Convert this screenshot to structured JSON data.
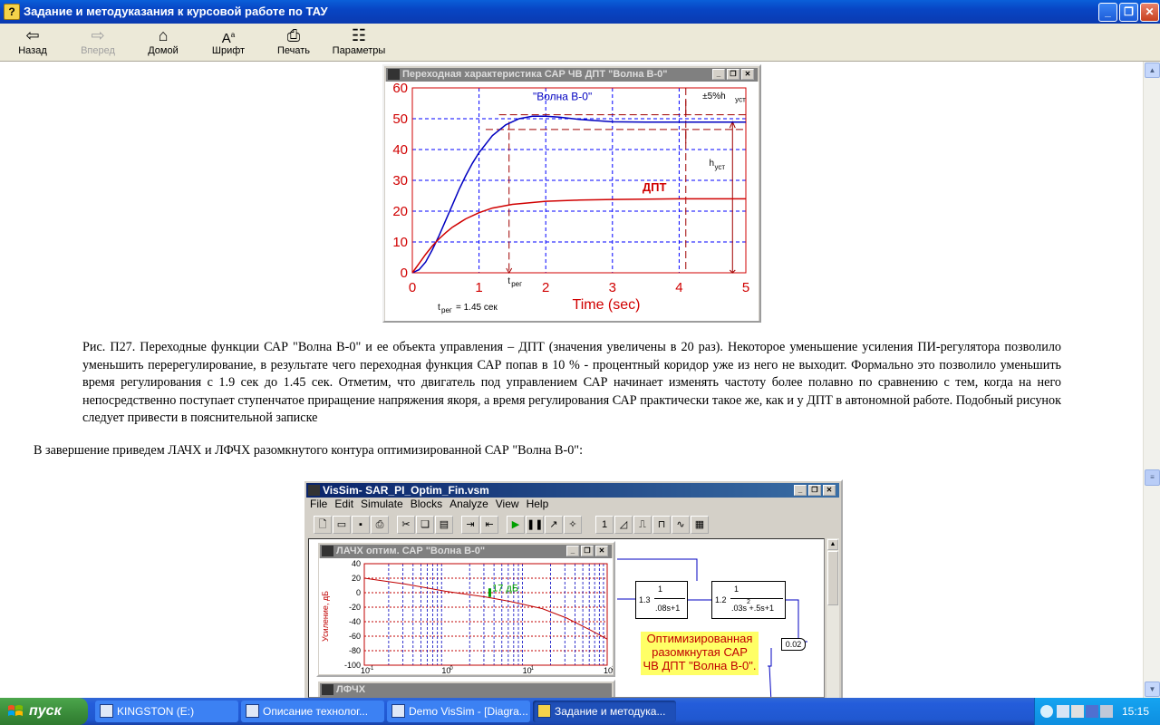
{
  "window": {
    "title": "Задание и методуказания к курсовой работе по ТАУ",
    "icon_letter": "?"
  },
  "toolbar": {
    "back": "Назад",
    "forward": "Вперед",
    "home": "Домой",
    "font": "Шрифт",
    "print": "Печать",
    "options": "Параметры"
  },
  "chart_window": {
    "title": "Переходная характеристика САР ЧВ ДПТ \"Волна В-0\"",
    "curve_label_blue": "\"Волна В-0\"",
    "curve_label_red": "ДПТ",
    "band_label": "±5%h",
    "band_sub": "уст",
    "hust_label": "h",
    "hust_sub": "уст",
    "treg_label": "t",
    "treg_sub": "рег",
    "treg_value": "= 1.45 сек",
    "xlabel": "Time (sec)"
  },
  "chart_data": {
    "type": "line",
    "xlabel": "Time (sec)",
    "ylabel": "",
    "xlim": [
      0,
      5
    ],
    "ylim": [
      0,
      60
    ],
    "xticks": [
      "0",
      "1",
      "2",
      "3",
      "4",
      "5"
    ],
    "yticks": [
      "0",
      "10",
      "20",
      "30",
      "40",
      "50",
      "60"
    ],
    "grid": true,
    "series": [
      {
        "name": "\"Волна В-0\"",
        "color": "#0000c0",
        "x": [
          0,
          0.1,
          0.2,
          0.3,
          0.4,
          0.5,
          0.6,
          0.7,
          0.8,
          0.9,
          1.0,
          1.2,
          1.4,
          1.6,
          1.8,
          2.0,
          2.2,
          2.5,
          3.0,
          3.5,
          4.0,
          4.5,
          5.0
        ],
        "y": [
          0,
          1,
          3.5,
          7.5,
          12,
          17,
          22,
          27,
          31.5,
          35.5,
          39,
          44.5,
          48,
          50,
          50.8,
          50.8,
          50.5,
          49.8,
          49,
          48.9,
          48.9,
          48.9,
          48.9
        ]
      },
      {
        "name": "ДПТ",
        "color": "#d00000",
        "x": [
          0,
          0.1,
          0.2,
          0.3,
          0.4,
          0.5,
          0.6,
          0.8,
          1.0,
          1.2,
          1.5,
          2.0,
          2.5,
          3.0,
          4.0,
          5.0
        ],
        "y": [
          0,
          3,
          6,
          8.7,
          11,
          13,
          14.8,
          17.5,
          19.5,
          21,
          22.2,
          23.2,
          23.6,
          23.8,
          24,
          24
        ]
      }
    ],
    "annotations": [
      {
        "text": "\"Волна В-0\"",
        "x": 2.0,
        "y": 56
      },
      {
        "text": "ДПТ",
        "x": 3.6,
        "y": 26
      },
      {
        "text": "t_рег",
        "x": 1.45,
        "y": -3
      },
      {
        "text": "h_уст",
        "x": 4.5,
        "y": 35
      },
      {
        "text": "±5%h_уст",
        "x": 4.5,
        "y": 56
      },
      {
        "text": "t_рег = 1.45 сек",
        "x": 0.4,
        "y": -11
      }
    ]
  },
  "caption": "Рис. П27. Переходные функции САР \"Волна В-0\" и ее объекта управления – ДПТ (значения увеличены в 20 раз). Некоторое уменьшение усиления ПИ-регулятора позволило уменьшить перерегулирование, в результате чего переходная функция САР попав в 10 % - процентный коридор уже из него не выходит. Формально это позволило уменьшить время регулирования с 1.9 сек до 1.45 сек. Отметим, что двигатель под управлением САР начинает изменять частоту более полавно по сравнению с тем, когда на него непосредственно поступает ступенчатое приращение напряжения якоря, а время регулирования САР практически такое же, как и у ДПТ в автономной работе. Подобный рисунок следует привести в пояснительной записке",
  "intro": "В завершение приведем ЛАЧХ и ЛФЧХ разомкнутого контура оптимизированной САР \"Волна В-0\":",
  "vissim": {
    "title": "VisSim- SAR_PI_Optim_Fin.vsm",
    "menu": [
      "File",
      "Edit",
      "Simulate",
      "Blocks",
      "Analyze",
      "View",
      "Help"
    ],
    "lachx_title": "ЛАЧХ оптим. САР \"Волна В-0\"",
    "lachx_ylabel": "Усиление, дБ",
    "lachx_yticks": [
      "40",
      "20",
      "0",
      "-20",
      "-40",
      "-60",
      "-80",
      "-100"
    ],
    "lachx_xticks": [
      "10",
      "10",
      "10",
      "10"
    ],
    "lachx_xexp": [
      "-1",
      "0",
      "1",
      "2"
    ],
    "lachx_marker": "17 дБ",
    "lfchx_title": "ЛФЧХ",
    "block1_gain": "1.3",
    "block1_num": "1",
    "block1_den": ".08s+1",
    "block2_gain": "1.2",
    "block2_num": "1",
    "block2_den": ".03s  +.5s+1",
    "block2_exp": "2",
    "gain_block": "0.02",
    "label_line1": "Оптимизированная",
    "label_line2": "разомкнутая  САР",
    "label_line3": "ЧВ ДПТ \"Волна В-0\"."
  },
  "taskbar": {
    "start": "пуск",
    "tasks": [
      "KINGSTON (E:)",
      "Описание технолог...",
      "Demo VisSim - [Diagra...",
      "Задание и методука..."
    ],
    "clock": "15:15"
  }
}
